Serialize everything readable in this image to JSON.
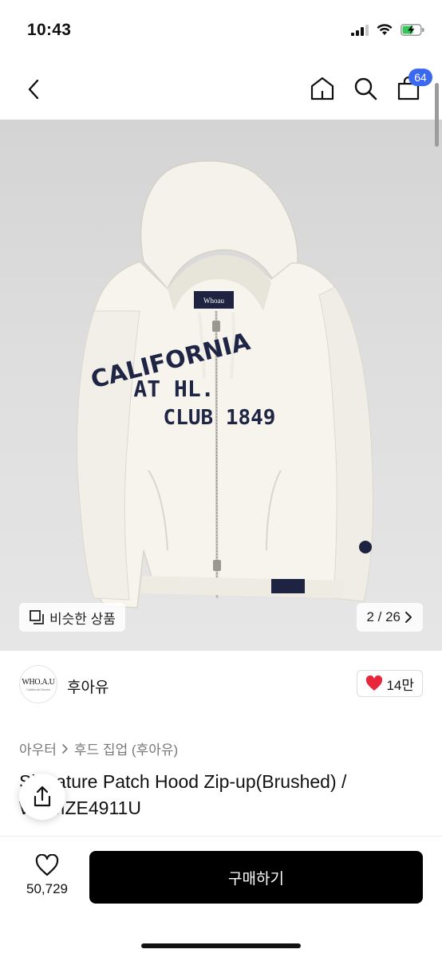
{
  "status_bar": {
    "time": "10:43",
    "icons": [
      "signal-icon",
      "wifi-icon",
      "battery-charging-icon"
    ]
  },
  "nav": {
    "cart_count": "64",
    "icons": [
      "back-icon",
      "home-icon",
      "search-icon",
      "cart-icon"
    ]
  },
  "gallery": {
    "image_alt": "hoodie photo",
    "patch_lines": [
      "CALIFORNIA",
      "AT  HL.",
      "CLUB 1849"
    ],
    "similar_label": "비슷한 상품",
    "page_current": "2",
    "page_total": "26",
    "page_separator": "/",
    "page_text": "2 / 26"
  },
  "brand": {
    "logo_text": "WHO.A.U",
    "logo_sub": "California Dream",
    "name": "후아유",
    "likes": "14만",
    "like_color": "#e8273b"
  },
  "breadcrumb": {
    "items": [
      "아우터",
      "후드 집업 (후아유)"
    ]
  },
  "product": {
    "title": "Signature Patch Hood Zip-up(Brushed) / WHMZE4911U"
  },
  "bottom": {
    "wish_count": "50,729",
    "buy_label": "구매하기"
  },
  "colors": {
    "accent": "#3b68f0",
    "buy_button": "#000000",
    "heart": "#e8273b"
  }
}
